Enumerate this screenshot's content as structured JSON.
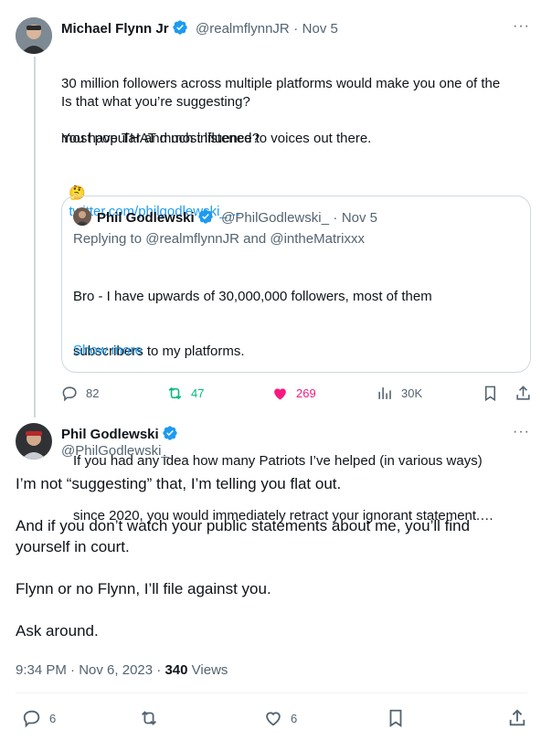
{
  "first_tweet": {
    "display_name": "Michael Flynn Jr",
    "handle": "@realmflynnJR",
    "separator": "·",
    "date": "Nov 5",
    "more": "···",
    "lines": [
      "30 million followers across multiple platforms would make you one of the",
      "most popular and most listened to voices out there."
    ],
    "question": "Is that what you’re suggesting?",
    "influence": "You have THAT much influence?",
    "emoji": "🤔",
    "link_text": "twitter.com/philgodlewski_…",
    "quote": {
      "display_name": "Phil Godlewski",
      "handle": "@PhilGodlewski_",
      "separator": "·",
      "date": "Nov 5",
      "replying_prefix": "Replying to",
      "replying_user1": "@realmflynnJR",
      "replying_and": "and",
      "replying_user2": "@intheMatrixxx",
      "para1_line1": "Bro - I have upwards of 30,000,000 followers, most of them",
      "para1_line2": "subscribers to my platforms.",
      "para2_line1": "If you had any idea how many Patriots I’ve helped (in various ways)",
      "para2_line2": "since 2020, you would immediately retract your ignorant statement.…",
      "show_more": "Show more"
    },
    "actions": {
      "replies": "82",
      "reposts": "47",
      "likes": "269",
      "views": "30K"
    }
  },
  "main_tweet": {
    "display_name": "Phil Godlewski",
    "handle": "@PhilGodlewski_",
    "more": "···",
    "para1": "I’m not “suggesting” that, I’m telling you flat out.",
    "para2_line1": "And if you don’t watch your public statements about me, you’ll find",
    "para2_line2": "yourself in court.",
    "para3": "Flynn or no Flynn, I’ll file against you.",
    "para4": "Ask around.",
    "time": "9:34 PM",
    "separator": "·",
    "date": "Nov 6, 2023",
    "views_count": "340",
    "views_label": "Views",
    "actions": {
      "replies": "6",
      "likes": "6"
    }
  },
  "colors": {
    "accent": "#1d9bf0",
    "like": "#f91880",
    "repost": "#00ba7c",
    "muted": "#536471",
    "border": "#cfd9de"
  }
}
